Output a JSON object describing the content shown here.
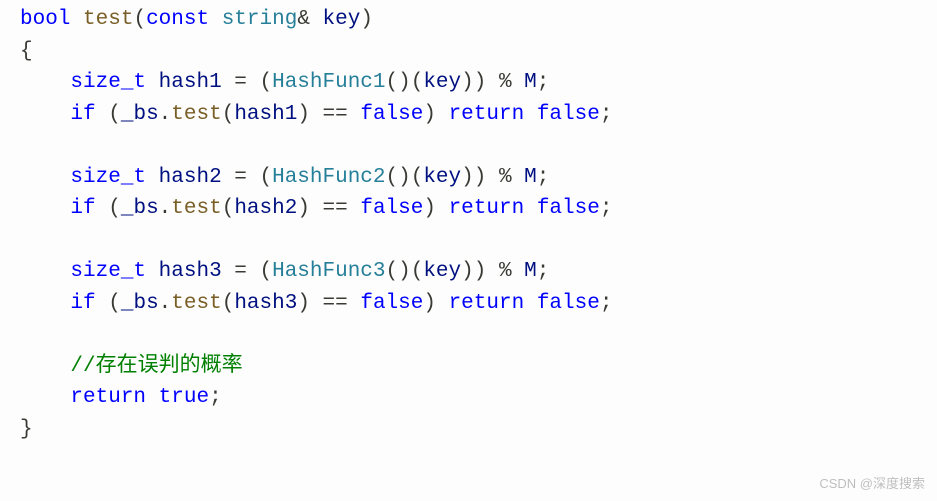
{
  "code": {
    "l1_kw_bool": "bool",
    "l1_fn_test": "test",
    "l1_p_open": "(",
    "l1_kw_const": "const",
    "l1_ty_string": "string",
    "l1_amp": "&",
    "l1_id_key": "key",
    "l1_p_close": ")",
    "l2_brace": "{",
    "l3_indent": "    ",
    "l3_kw_sizet": "size_t",
    "l3_id_hash1": "hash1",
    "l3_eq": " = ",
    "l3_p1": "(",
    "l3_ty_hf1": "HashFunc1",
    "l3_p2": "()(",
    "l3_id_key": "key",
    "l3_p3": ")) % ",
    "l3_id_M": "M",
    "l3_semi": ";",
    "l4_indent": "    ",
    "l4_kw_if": "if",
    "l4_p1": " (",
    "l4_id_bs": "_bs",
    "l4_dot": ".",
    "l4_fn_test": "test",
    "l4_p2": "(",
    "l4_id_hash1": "hash1",
    "l4_p3": ") == ",
    "l4_kw_false": "false",
    "l4_p4": ") ",
    "l4_kw_return": "return",
    "l4_sp": " ",
    "l4_kw_false2": "false",
    "l4_semi": ";",
    "l6_indent": "    ",
    "l6_kw_sizet": "size_t",
    "l6_id_hash2": "hash2",
    "l6_eq": " = ",
    "l6_p1": "(",
    "l6_ty_hf2": "HashFunc2",
    "l6_p2": "()(",
    "l6_id_key": "key",
    "l6_p3": ")) % ",
    "l6_id_M": "M",
    "l6_semi": ";",
    "l7_indent": "    ",
    "l7_kw_if": "if",
    "l7_p1": " (",
    "l7_id_bs": "_bs",
    "l7_dot": ".",
    "l7_fn_test": "test",
    "l7_p2": "(",
    "l7_id_hash2": "hash2",
    "l7_p3": ") == ",
    "l7_kw_false": "false",
    "l7_p4": ") ",
    "l7_kw_return": "return",
    "l7_sp": " ",
    "l7_kw_false2": "false",
    "l7_semi": ";",
    "l9_indent": "    ",
    "l9_kw_sizet": "size_t",
    "l9_id_hash3": "hash3",
    "l9_eq": " = ",
    "l9_p1": "(",
    "l9_ty_hf3": "HashFunc3",
    "l9_p2": "()(",
    "l9_id_key": "key",
    "l9_p3": ")) % ",
    "l9_id_M": "M",
    "l9_semi": ";",
    "l10_indent": "    ",
    "l10_kw_if": "if",
    "l10_p1": " (",
    "l10_id_bs": "_bs",
    "l10_dot": ".",
    "l10_fn_test": "test",
    "l10_p2": "(",
    "l10_id_hash3": "hash3",
    "l10_p3": ") == ",
    "l10_kw_false": "false",
    "l10_p4": ") ",
    "l10_kw_return": "return",
    "l10_sp": " ",
    "l10_kw_false2": "false",
    "l10_semi": ";",
    "l12_indent": "    ",
    "l12_comment": "//存在误判的概率",
    "l13_indent": "    ",
    "l13_kw_return": "return",
    "l13_sp": " ",
    "l13_kw_true": "true",
    "l13_semi": ";",
    "l14_brace": "}"
  },
  "watermark": "CSDN @深度搜索"
}
